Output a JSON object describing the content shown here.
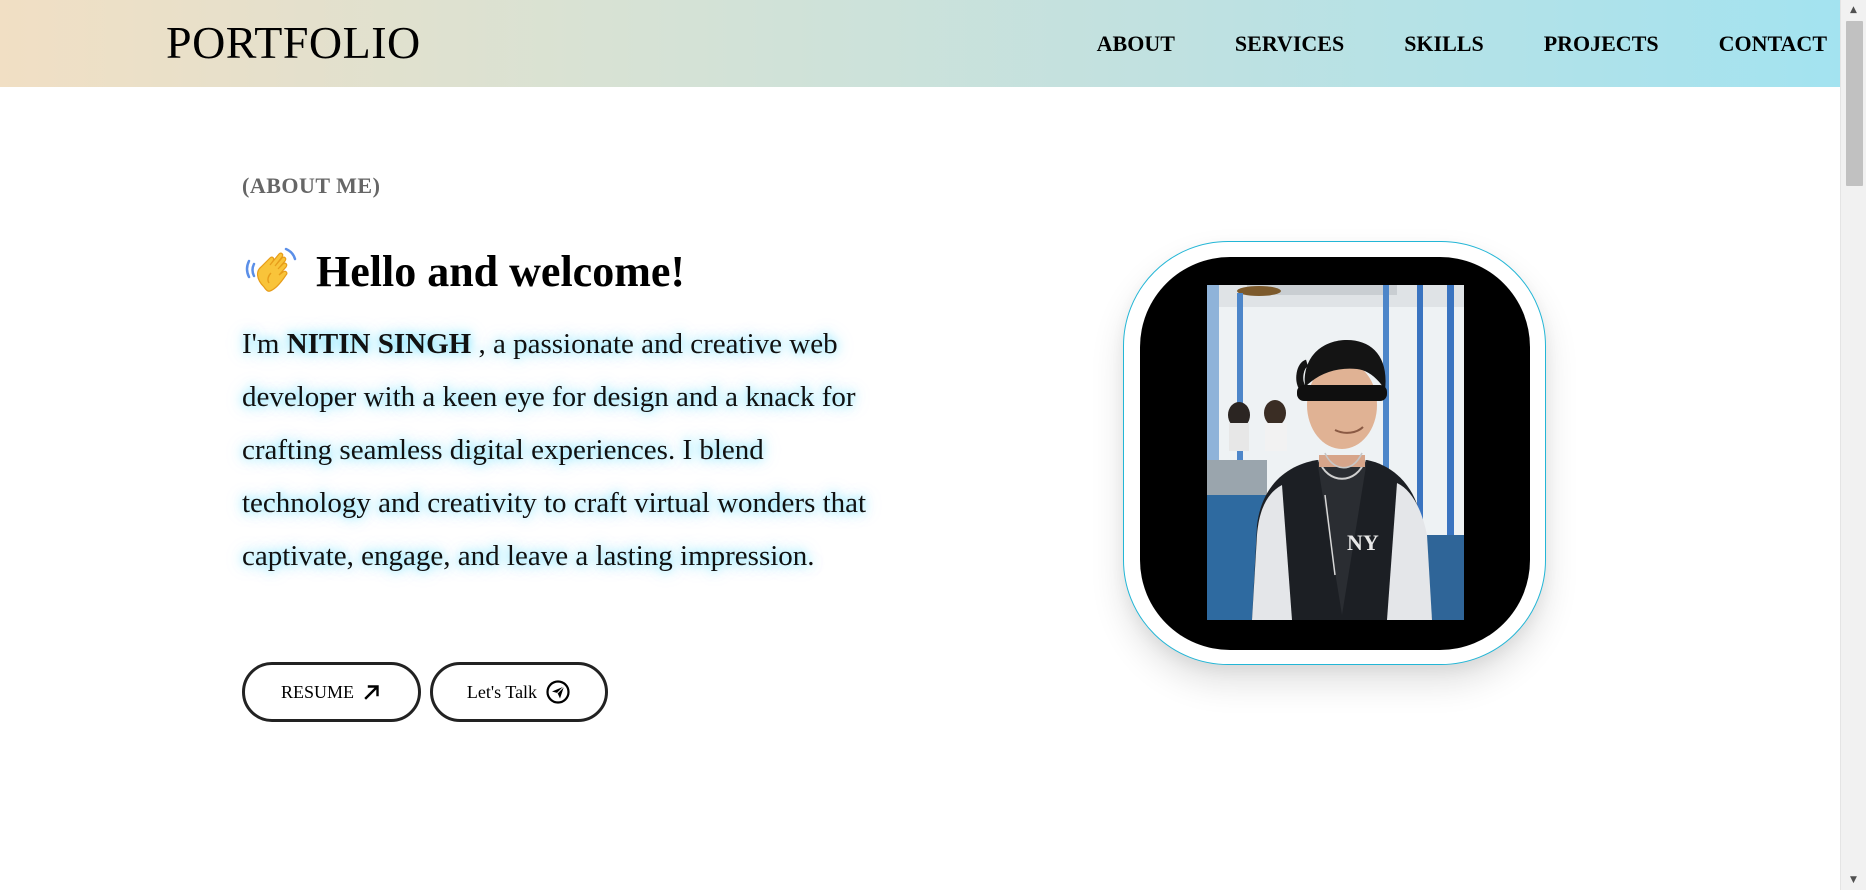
{
  "nav": {
    "logo": "PORTFOLIO",
    "links": [
      "ABOUT",
      "SERVICES",
      "SKILLS",
      "PROJECTS",
      "CONTACT"
    ]
  },
  "about": {
    "tag": "(ABOUT ME)",
    "heading_emoji_icon": "waving-hand-icon",
    "heading": "Hello and welcome!",
    "bio_prefix": "I'm ",
    "name": "NITIN SINGH",
    "bio_rest": " , a passionate and creative web developer with a keen eye for design and a knack for crafting seamless digital experiences. I blend technology and creativity to craft virtual wonders that captivate, engage, and leave a lasting impression.",
    "buttons": {
      "resume_label": "RESUME",
      "resume_icon": "arrow-up-right-icon",
      "talk_label": "Let's Talk",
      "talk_icon": "paper-plane-icon"
    }
  },
  "colors": {
    "nav_gradient_start": "#f1dfc4",
    "nav_gradient_end": "#a3e3f0",
    "ring_border": "#23b6d6",
    "bio_glow": "#00cdff"
  }
}
